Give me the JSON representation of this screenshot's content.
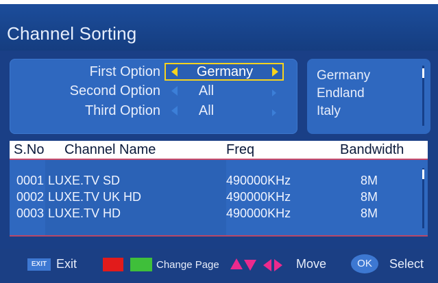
{
  "title": "Channel Sorting",
  "options": [
    {
      "label": "First Option",
      "value": "Germany",
      "selected": true
    },
    {
      "label": "Second Option",
      "value": "All",
      "selected": false
    },
    {
      "label": "Third Option",
      "value": "All",
      "selected": false
    }
  ],
  "country_list": [
    "Germany",
    "Endland",
    "Italy"
  ],
  "table": {
    "headers": {
      "sno": "S.No",
      "name": "Channel Name",
      "freq": "Freq",
      "bandwidth": "Bandwidth"
    },
    "rows": [
      {
        "sno": "0001",
        "name": "LUXE.TV SD",
        "freq": "490000KHz",
        "bandwidth": "8M"
      },
      {
        "sno": "0002",
        "name": "LUXE.TV UK HD",
        "freq": "490000KHz",
        "bandwidth": "8M"
      },
      {
        "sno": "0003",
        "name": "LUXE.TV HD",
        "freq": "490000KHz",
        "bandwidth": "8M"
      }
    ]
  },
  "footer": {
    "exit_key": "EXIT",
    "exit_label": "Exit",
    "change_page_label": "Change Page",
    "move_label": "Move",
    "ok_key": "OK",
    "select_label": "Select"
  },
  "colors": {
    "highlight": "#f7d31e",
    "red_key": "#e21b1b",
    "green_key": "#3fbf3a",
    "background": "#1a3f86"
  },
  "icons": [
    "arrow-left-icon",
    "arrow-right-icon",
    "arrow-up-icon",
    "arrow-down-icon",
    "red-key-icon",
    "green-key-icon"
  ]
}
